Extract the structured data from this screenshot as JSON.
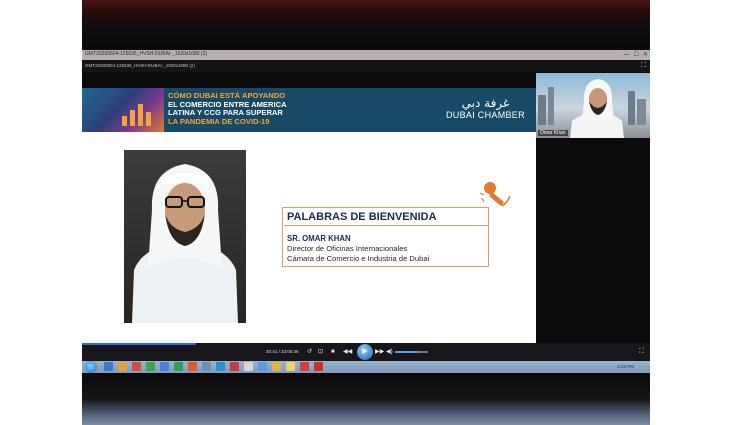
{
  "window": {
    "title": "GMT20200604-125636_HVSH-DUBAI-_1920x1080 (2)",
    "controls": [
      "—",
      "☐",
      "✕"
    ]
  },
  "meeting_bar": {
    "title": "GMT20200604-125636_HVSH-DUBAI-_1920x1080 (2)",
    "expand_icon": "expand-icon"
  },
  "slide": {
    "headline": {
      "lines": [
        {
          "text": "CÓMO DUBAI ESTÁ APOYANDO",
          "color": "#f4a23a"
        },
        {
          "text": "EL COMERCIO ENTRE AMERICA",
          "color": "#ffffff"
        },
        {
          "text": "LATINA Y CCG PARA SUPERAR",
          "color": "#ffffff"
        },
        {
          "text": "LA PANDEMIA DE COVID-19",
          "color": "#f4a23a"
        }
      ]
    },
    "logo": {
      "arabic": "غرفة دبي",
      "english": "DUBAI CHAMBER"
    },
    "welcome": {
      "title": "PALABRAS DE BIENVENIDA",
      "name": "SR. OMAR KHAN",
      "role": "Director de Oficinas Internacionales",
      "organization": "Cámara de Comercio e Industria de Dubai"
    },
    "accent_color": "#e07a32"
  },
  "webcam": {
    "caption": "Omar Khan"
  },
  "player": {
    "time": "20:41 / 33:05:46",
    "progress_fraction": 0.2,
    "volume_fraction": 0.7,
    "controls": {
      "prev_frame": "↺",
      "stop_alt": "⊡",
      "stop": "■",
      "rewind": "◀◀",
      "play": "▶",
      "forward": "▶▶",
      "volume": "◀)",
      "fullscreen": "⛶"
    }
  },
  "taskbar": {
    "tray_time": "2:23 PM"
  },
  "colors": {
    "banner": "#174a66",
    "navy_text": "#1f2a44",
    "box_border": "#e09a6a"
  }
}
